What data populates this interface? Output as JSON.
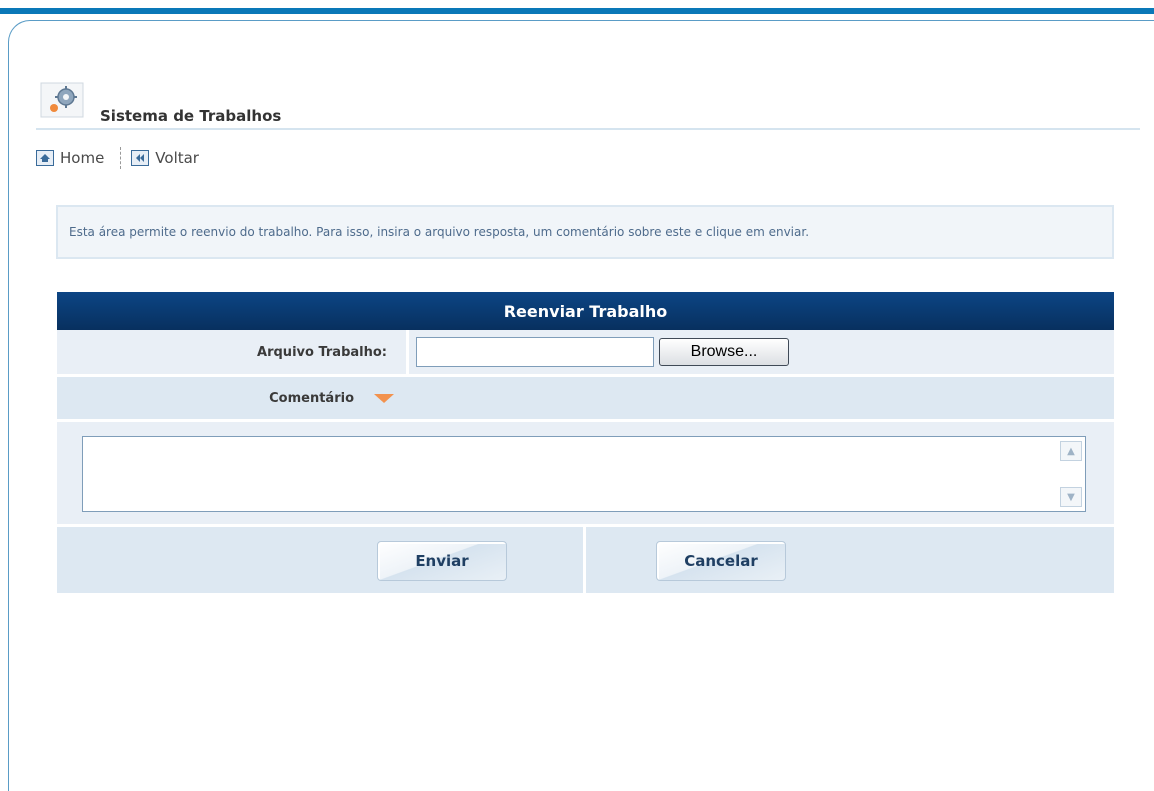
{
  "header": {
    "title": "Sistema de Trabalhos",
    "icon": "gear-icon"
  },
  "nav": {
    "home_label": "Home",
    "back_label": "Voltar"
  },
  "info": {
    "text": "Esta área permite o reenvio do trabalho. Para isso, insira o arquivo resposta, um comentário sobre este e clique em enviar."
  },
  "form": {
    "title": "Reenviar Trabalho",
    "file_label": "Arquivo Trabalho:",
    "file_value": "",
    "browse_label": "Browse...",
    "comment_label": "Comentário",
    "comment_value": "",
    "send_label": "Enviar",
    "cancel_label": "Cancelar"
  },
  "colors": {
    "accent": "#0a78b8",
    "header_bg": "#0c4585",
    "arrow": "#f2924e"
  }
}
